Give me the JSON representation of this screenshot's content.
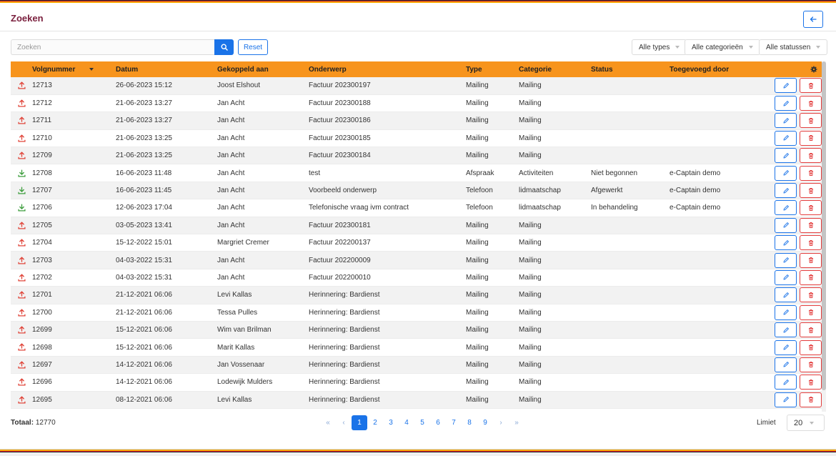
{
  "page": {
    "title": "Zoeken"
  },
  "search": {
    "placeholder": "Zoeken",
    "value": "",
    "reset_label": "Reset"
  },
  "filters": {
    "types": "Alle types",
    "categories": "Alle categorieën",
    "statuses": "Alle statussen"
  },
  "table": {
    "columns": [
      "Volgnummer",
      "Datum",
      "Gekoppeld aan",
      "Onderwerp",
      "Type",
      "Categorie",
      "Status",
      "Toegevoegd door"
    ],
    "rows": [
      {
        "id": "12713",
        "date": "26-06-2023 15:12",
        "linked": "Joost Elshout",
        "subject": "Factuur 202300197",
        "type": "Mailing",
        "category": "Mailing",
        "status": "",
        "added_by": "",
        "direction": "out"
      },
      {
        "id": "12712",
        "date": "21-06-2023 13:27",
        "linked": "Jan Acht",
        "subject": "Factuur 202300188",
        "type": "Mailing",
        "category": "Mailing",
        "status": "",
        "added_by": "",
        "direction": "out"
      },
      {
        "id": "12711",
        "date": "21-06-2023 13:27",
        "linked": "Jan Acht",
        "subject": "Factuur 202300186",
        "type": "Mailing",
        "category": "Mailing",
        "status": "",
        "added_by": "",
        "direction": "out"
      },
      {
        "id": "12710",
        "date": "21-06-2023 13:25",
        "linked": "Jan Acht",
        "subject": "Factuur 202300185",
        "type": "Mailing",
        "category": "Mailing",
        "status": "",
        "added_by": "",
        "direction": "out"
      },
      {
        "id": "12709",
        "date": "21-06-2023 13:25",
        "linked": "Jan Acht",
        "subject": "Factuur 202300184",
        "type": "Mailing",
        "category": "Mailing",
        "status": "",
        "added_by": "",
        "direction": "out"
      },
      {
        "id": "12708",
        "date": "16-06-2023 11:48",
        "linked": "Jan Acht",
        "subject": "test",
        "type": "Afspraak",
        "category": "Activiteiten",
        "status": "Niet begonnen",
        "added_by": "e-Captain demo",
        "direction": "in"
      },
      {
        "id": "12707",
        "date": "16-06-2023 11:45",
        "linked": "Jan Acht",
        "subject": "Voorbeeld onderwerp",
        "type": "Telefoon",
        "category": "lidmaatschap",
        "status": "Afgewerkt",
        "added_by": "e-Captain demo",
        "direction": "in"
      },
      {
        "id": "12706",
        "date": "12-06-2023 17:04",
        "linked": "Jan Acht",
        "subject": "Telefonische vraag ivm contract",
        "type": "Telefoon",
        "category": "lidmaatschap",
        "status": "In behandeling",
        "added_by": "e-Captain demo",
        "direction": "in"
      },
      {
        "id": "12705",
        "date": "03-05-2023 13:41",
        "linked": "Jan Acht",
        "subject": "Factuur 202300181",
        "type": "Mailing",
        "category": "Mailing",
        "status": "",
        "added_by": "",
        "direction": "out"
      },
      {
        "id": "12704",
        "date": "15-12-2022 15:01",
        "linked": "Margriet Cremer",
        "subject": "Factuur 202200137",
        "type": "Mailing",
        "category": "Mailing",
        "status": "",
        "added_by": "",
        "direction": "out"
      },
      {
        "id": "12703",
        "date": "04-03-2022 15:31",
        "linked": "Jan Acht",
        "subject": "Factuur 202200009",
        "type": "Mailing",
        "category": "Mailing",
        "status": "",
        "added_by": "",
        "direction": "out"
      },
      {
        "id": "12702",
        "date": "04-03-2022 15:31",
        "linked": "Jan Acht",
        "subject": "Factuur 202200010",
        "type": "Mailing",
        "category": "Mailing",
        "status": "",
        "added_by": "",
        "direction": "out"
      },
      {
        "id": "12701",
        "date": "21-12-2021 06:06",
        "linked": "Levi Kallas",
        "subject": "Herinnering: Bardienst",
        "type": "Mailing",
        "category": "Mailing",
        "status": "",
        "added_by": "",
        "direction": "out"
      },
      {
        "id": "12700",
        "date": "21-12-2021 06:06",
        "linked": "Tessa Pulles",
        "subject": "Herinnering: Bardienst",
        "type": "Mailing",
        "category": "Mailing",
        "status": "",
        "added_by": "",
        "direction": "out"
      },
      {
        "id": "12699",
        "date": "15-12-2021 06:06",
        "linked": "Wim van Brilman",
        "subject": "Herinnering: Bardienst",
        "type": "Mailing",
        "category": "Mailing",
        "status": "",
        "added_by": "",
        "direction": "out"
      },
      {
        "id": "12698",
        "date": "15-12-2021 06:06",
        "linked": "Marit Kallas",
        "subject": "Herinnering: Bardienst",
        "type": "Mailing",
        "category": "Mailing",
        "status": "",
        "added_by": "",
        "direction": "out"
      },
      {
        "id": "12697",
        "date": "14-12-2021 06:06",
        "linked": "Jan Vossenaar",
        "subject": "Herinnering: Bardienst",
        "type": "Mailing",
        "category": "Mailing",
        "status": "",
        "added_by": "",
        "direction": "out"
      },
      {
        "id": "12696",
        "date": "14-12-2021 06:06",
        "linked": "Lodewijk Mulders",
        "subject": "Herinnering: Bardienst",
        "type": "Mailing",
        "category": "Mailing",
        "status": "",
        "added_by": "",
        "direction": "out"
      },
      {
        "id": "12695",
        "date": "08-12-2021 06:06",
        "linked": "Levi Kallas",
        "subject": "Herinnering: Bardienst",
        "type": "Mailing",
        "category": "Mailing",
        "status": "",
        "added_by": "",
        "direction": "out"
      }
    ]
  },
  "footer": {
    "total_label": "Totaal:",
    "total_value": "12770",
    "pagination": {
      "first": "«",
      "prev": "‹",
      "next": "›",
      "last": "»",
      "pages": [
        "1",
        "2",
        "3",
        "4",
        "5",
        "6",
        "7",
        "8",
        "9"
      ],
      "current": "1"
    },
    "limit_label": "Limiet",
    "limit_value": "20"
  },
  "colors": {
    "accent": "#1a73e8",
    "header_bg": "#f7941d",
    "title": "#7a1f3d",
    "delete": "#e23c3c",
    "icon_out": "#e0453a",
    "icon_in": "#3f9e3f"
  },
  "icons": {
    "back": "arrow-left-icon",
    "search": "search-icon",
    "settings": "gear-icon",
    "edit": "pencil-icon",
    "delete": "trash-icon",
    "outgoing": "upload-icon",
    "incoming": "download-icon"
  }
}
